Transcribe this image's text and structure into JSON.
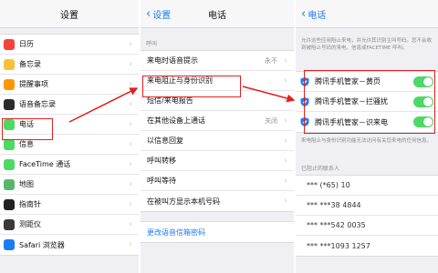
{
  "panel1": {
    "title": "设置",
    "items": [
      {
        "label": "日历",
        "color": "#f2443b"
      },
      {
        "label": "备忘录",
        "color": "#f7c23a"
      },
      {
        "label": "提醒事项",
        "color": "#ff9500"
      },
      {
        "label": "语音备忘录",
        "color": "#2b2b2b"
      },
      {
        "label": "电话",
        "color": "#4cd964"
      },
      {
        "label": "信息",
        "color": "#4cd964"
      },
      {
        "label": "FaceTime 通话",
        "color": "#4cd964"
      },
      {
        "label": "地图",
        "color": "#59b66d"
      },
      {
        "label": "指南针",
        "color": "#222222"
      },
      {
        "label": "测距仪",
        "color": "#3a3a3a"
      },
      {
        "label": "Safari 浏览器",
        "color": "#1a7cf5"
      }
    ]
  },
  "panel2": {
    "back": "设置",
    "title": "电话",
    "section": "呼叫",
    "items": [
      {
        "label": "来电时语音提示",
        "value": "永不"
      },
      {
        "label": "来电阻止与身份识别",
        "value": ""
      },
      {
        "label": "短信/来电报告",
        "value": ""
      },
      {
        "label": "在其他设备上通话",
        "value": "关闭"
      },
      {
        "label": "以信息回复",
        "value": ""
      },
      {
        "label": "呼叫转移",
        "value": ""
      },
      {
        "label": "呼叫等待",
        "value": ""
      },
      {
        "label": "在被叫方显示本机号码",
        "value": ""
      }
    ],
    "voicemail": "更改语音信箱密码"
  },
  "panel3": {
    "back": "电话",
    "description": "允许这些应用阻止来电，并允许其识别主叫号码。您不会收到被阻止号码的来电、信息或FACETIME 呼叫。",
    "apps": [
      {
        "label": "腾讯手机管家－黄页"
      },
      {
        "label": "腾讯手机管家－拦骚扰"
      },
      {
        "label": "腾讯手机管家－识来电"
      }
    ],
    "note": "来电阻止与身份识别功能无法访问有关您来电的任何信息。",
    "blocked_header": "已阻止的联系人",
    "blocked": [
      "*** (*65) 10",
      "*** ***38 4844",
      "*** ***542 0035",
      "*** ***1093 1257"
    ]
  },
  "accent": "#1a7cf5",
  "highlight": "#e0201e"
}
